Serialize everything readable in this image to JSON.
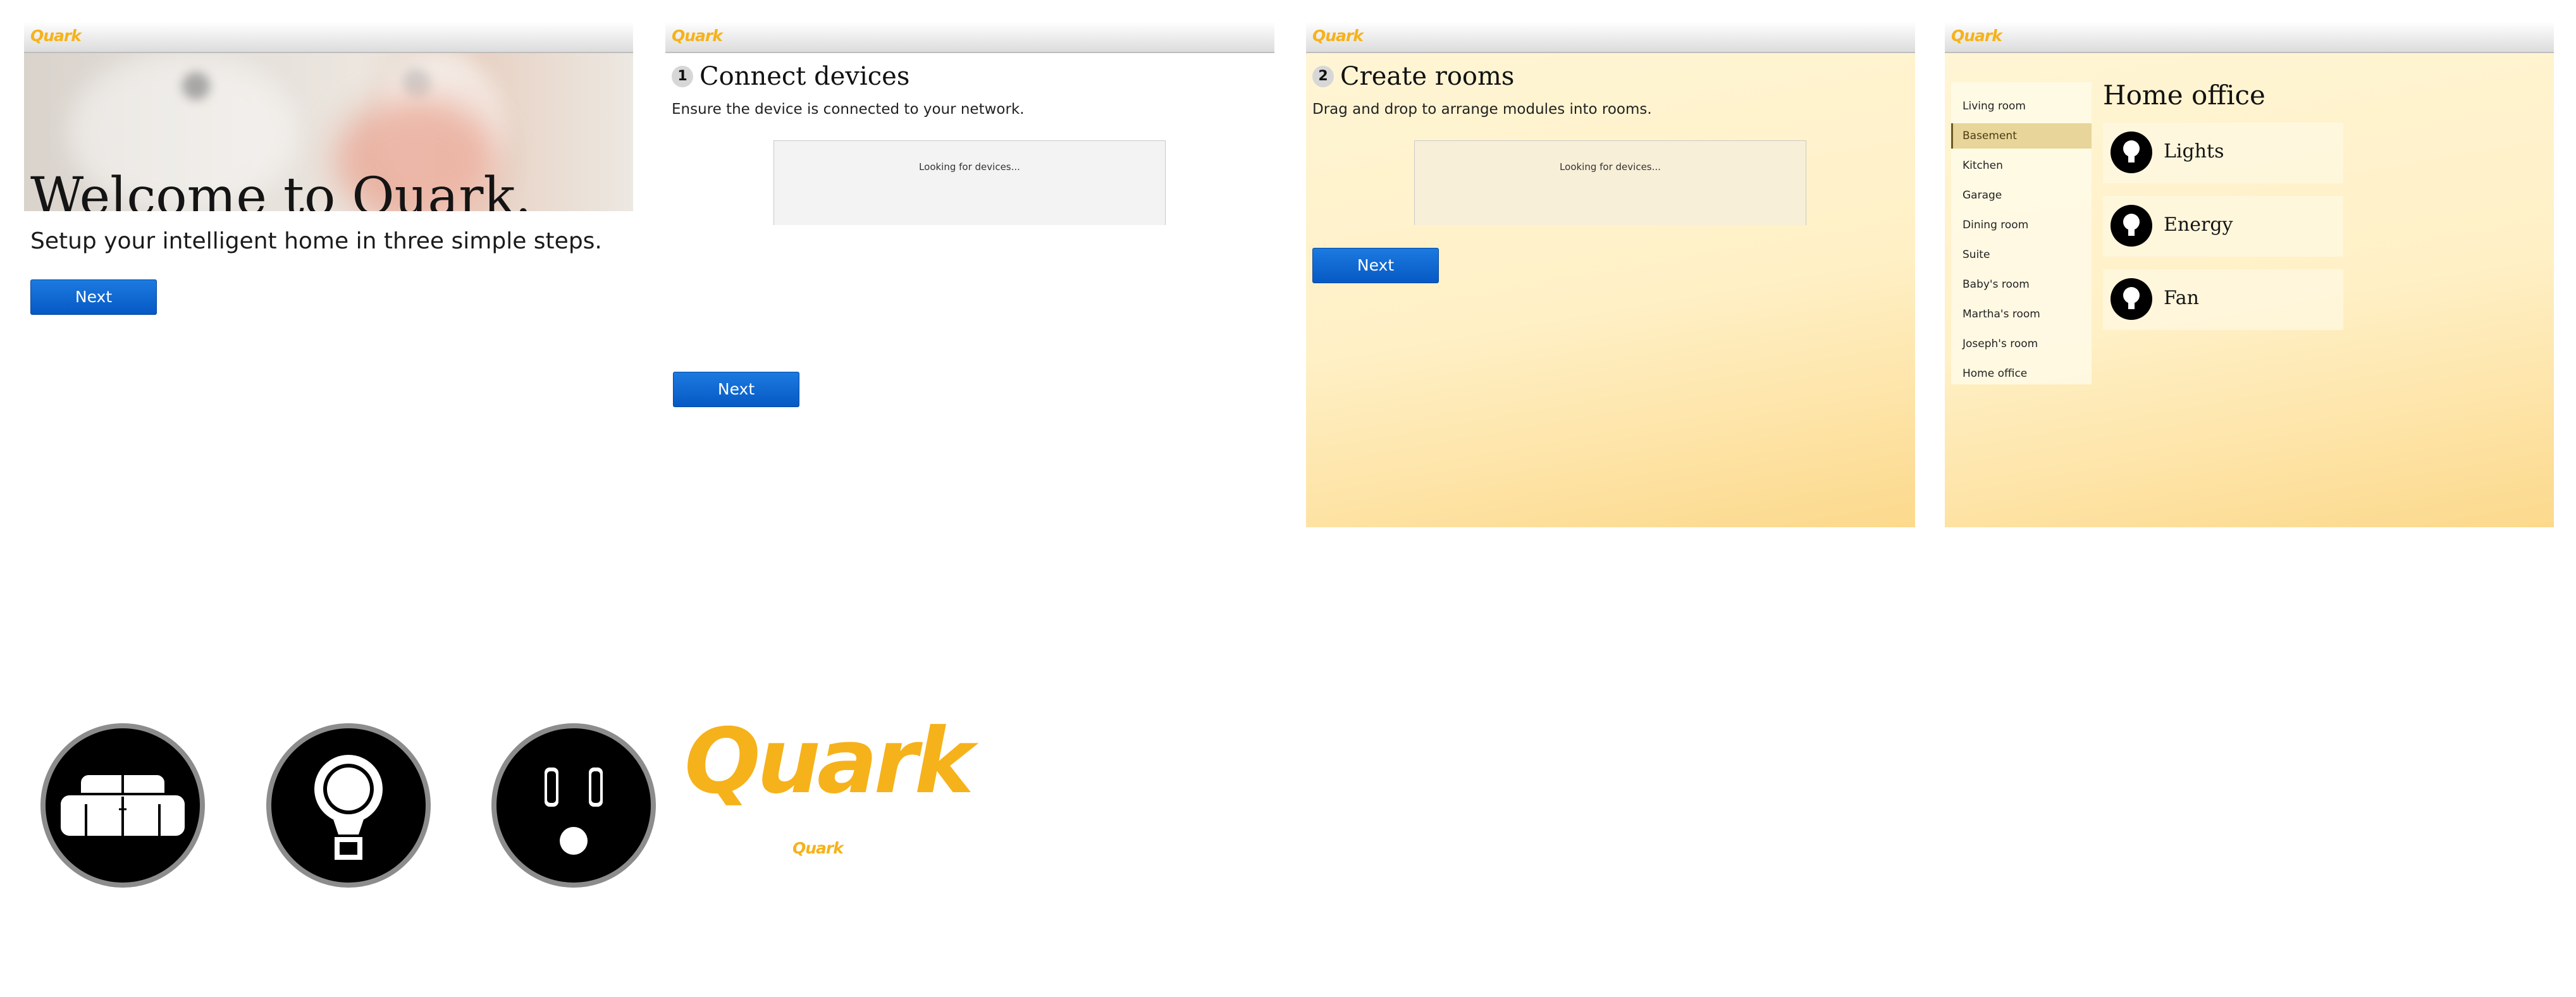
{
  "brand": {
    "name": "Quark",
    "color": "#f6b21a"
  },
  "accent_colors": {
    "button": "#0a63cf",
    "selected_room": "#e8d59a",
    "panel_bg": "#fff1c8"
  },
  "panel_welcome": {
    "title": "Welcome to Quark.",
    "subtitle": "Setup your intelligent home in three simple steps.",
    "next_label": "Next"
  },
  "panel_connect": {
    "step_number": "1",
    "title": "Connect devices",
    "description": "Ensure the device is connected to your network.",
    "status_text": "Looking for devices...",
    "next_label": "Next"
  },
  "panel_rooms": {
    "step_number": "2",
    "title": "Create rooms",
    "description": "Drag and drop to arrange modules into rooms.",
    "status_text": "Looking for devices...",
    "next_label": "Next"
  },
  "panel_office": {
    "rooms": [
      "Living room",
      "Basement",
      "Kitchen",
      "Garage",
      "Dining room",
      "Suite",
      "Baby's room",
      "Martha's room",
      "Joseph's room",
      "Home office"
    ],
    "selected_room": "Basement",
    "title": "Home office",
    "modules": [
      {
        "label": "Lights",
        "icon": "lightbulb-icon"
      },
      {
        "label": "Energy",
        "icon": "lightbulb-icon"
      },
      {
        "label": "Fan",
        "icon": "lightbulb-icon"
      }
    ]
  },
  "assets": {
    "icons": [
      "sofa-icon",
      "lightbulb-icon",
      "power-outlet-icon"
    ],
    "logo_large": "Quark",
    "logo_small": "Quark"
  }
}
